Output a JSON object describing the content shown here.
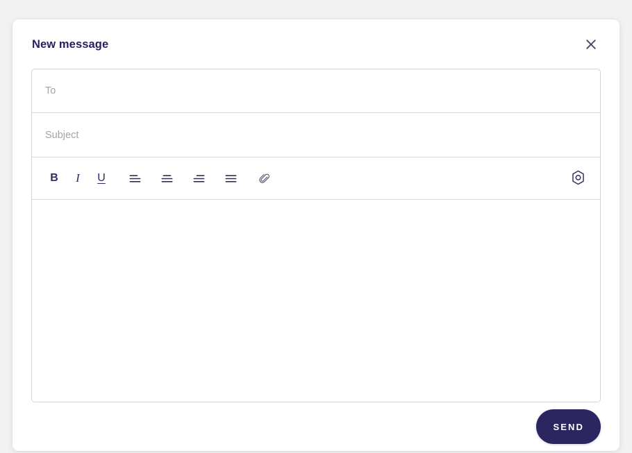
{
  "dialog": {
    "title": "New message",
    "close_icon": "close-icon",
    "close_label": "Close"
  },
  "fields": {
    "to": {
      "placeholder": "To",
      "value": ""
    },
    "subject": {
      "placeholder": "Subject",
      "value": ""
    },
    "body": {
      "placeholder": "",
      "value": ""
    }
  },
  "toolbar": {
    "items": [
      {
        "name": "bold-button",
        "icon": "bold-icon",
        "label": "B"
      },
      {
        "name": "italic-button",
        "icon": "italic-icon",
        "label": "I"
      },
      {
        "name": "underline-button",
        "icon": "underline-icon",
        "label": "U"
      },
      {
        "name": "align-left-button",
        "icon": "align-left-icon",
        "label": ""
      },
      {
        "name": "align-center-button",
        "icon": "align-center-icon",
        "label": ""
      },
      {
        "name": "align-right-button",
        "icon": "align-right-icon",
        "label": ""
      },
      {
        "name": "align-justify-button",
        "icon": "align-justify-icon",
        "label": ""
      },
      {
        "name": "attachment-button",
        "icon": "paperclip-icon",
        "label": ""
      }
    ],
    "settings": {
      "name": "settings-button",
      "icon": "hex-settings-icon",
      "label": "Settings"
    }
  },
  "footer": {
    "send_label": "Send"
  },
  "colors": {
    "accent": "#2b2560",
    "title": "#262260",
    "icon": "#2f2c63",
    "placeholder": "#a3a3aa",
    "border": "#d4d4d8",
    "divider": "#d9d9dd",
    "page_background": "#f2f2f3",
    "dialog_background": "#ffffff",
    "close_icon": "#4a4a66",
    "send_text": "#ffffff"
  }
}
